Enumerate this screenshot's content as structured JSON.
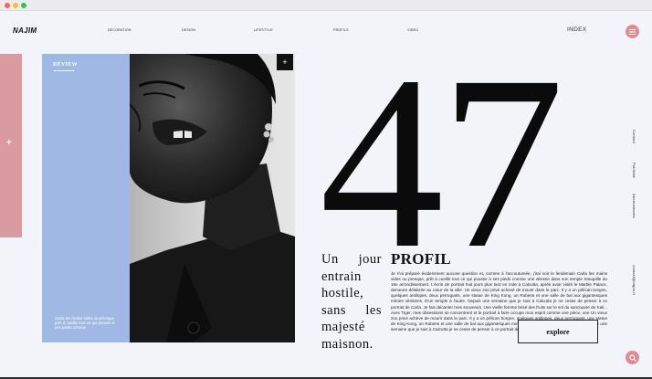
{
  "header": {
    "brand": "NAJIM",
    "nav": [
      "DECORATION",
      "DESIGN",
      "LIFESTYLE",
      "PROFILS",
      "VIDEO"
    ],
    "index_label": "INDEX"
  },
  "review": {
    "label": "REVIEW",
    "text": "Carla les mains vides ou presque, prêt à cueillir tout ce qui pousse à ses pieds comme"
  },
  "feature": {
    "number": "47",
    "quote": "Un jour entrain hostile, sans les majesté maisnon.",
    "title": "PROFIL",
    "body": "Je n'ai préparé évidemment aucune question et, comme à l'accoutumée, j'irai voir le lendemain Carla les mains vides ou presque, prêt à cueillir tout ce qui pousse à ses pieds comme une déesse dans son temple tranquille du 16e arrondissement. L'écrin de portrait huit jours plus tard en Inde à Calcutta, après avoir visité le Marble Palace, demeure délabrée au cœur de la ville. Un vieux zoo privé achevé de mourir dans le parc. Il y a un pélican borgne, quelques antilopes, deux perroquets, une statue de King Kong, un Rubens et une salle de bal aux gigantesques miroirs vénitiens. D'un temple à l'autre. Depuis une semaine que je suis à Calcutta je ne cesse de penser à ce portrait de Carla. Je fais décanter mes souvenirs. Une vieille femme brisé des fruits sur le sol du sanctuaire de Kali... Avec Tiger, mes obsessions se concentrent et le portrait à faire occupe mon esprit comme une pièce, une Un vieux zoo privé achève de mourir dans le parc. Il y a un pélican borgne, quelques antilopes, deux perroquets, une statue de King Kong, un Rubens et une salle de bal aux gigantesques miroirs vénitiens. D'un temple à l'autre. Depuis une semaine que je suis à Calcutta je ne cesse de penser à ce portrait de Carla. Je fais",
    "explore_label": "explore"
  },
  "side_links": [
    "Contact",
    "Publicité",
    "Abonnements",
    "contact@najim.fr"
  ],
  "colors": {
    "accent_pink": "#e08a92",
    "panel_pink": "#d99ba0",
    "panel_blue": "#9fb9e4",
    "background": "#f3f4f9"
  },
  "icons": {
    "menu": "hamburger-icon",
    "search": "search-icon",
    "plus": "plus-icon"
  }
}
